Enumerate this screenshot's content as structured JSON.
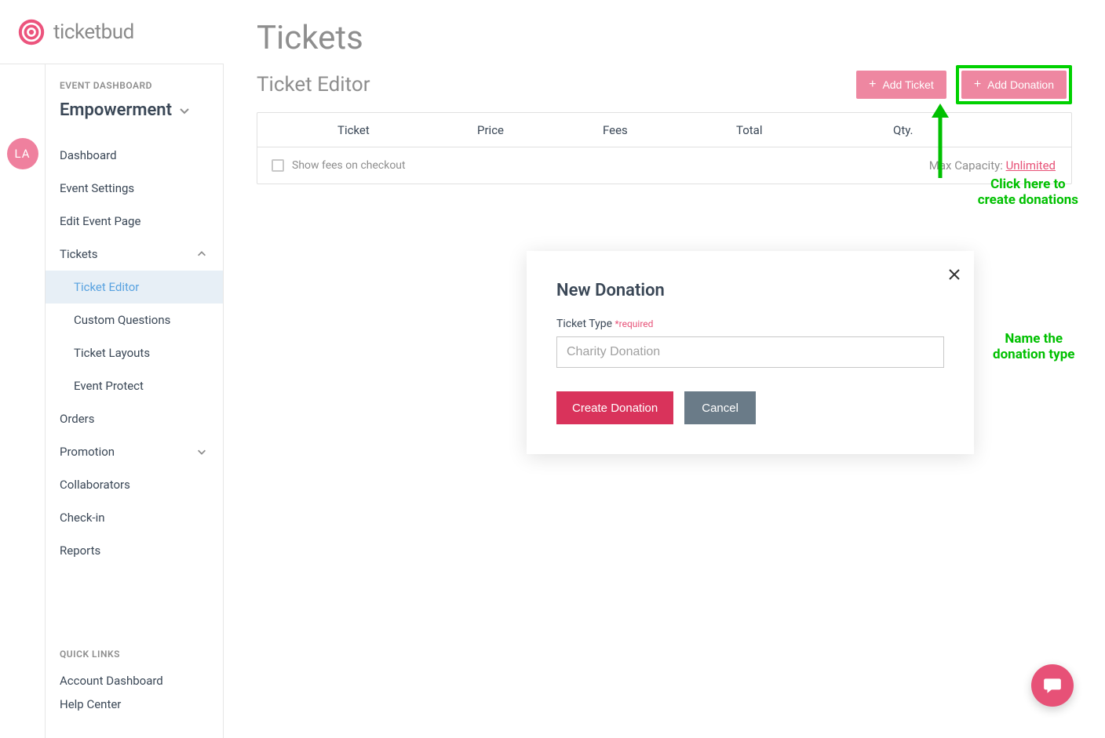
{
  "brand": {
    "name": "ticketbud",
    "avatar_initials": "LA"
  },
  "sidebar": {
    "dash_label": "EVENT DASHBOARD",
    "event_name": "Empowerment",
    "items": [
      {
        "label": "Dashboard"
      },
      {
        "label": "Event Settings"
      },
      {
        "label": "Edit Event Page"
      },
      {
        "label": "Tickets",
        "expanded": true
      },
      {
        "label": "Orders"
      },
      {
        "label": "Promotion",
        "expandable": true
      },
      {
        "label": "Collaborators"
      },
      {
        "label": "Check-in"
      },
      {
        "label": "Reports"
      }
    ],
    "tickets_sub": [
      {
        "label": "Ticket Editor",
        "active": true
      },
      {
        "label": "Custom Questions"
      },
      {
        "label": "Ticket Layouts"
      },
      {
        "label": "Event Protect"
      }
    ],
    "quick_links_label": "QUICK LINKS",
    "quick_links": [
      {
        "label": "Account Dashboard"
      },
      {
        "label": "Help Center"
      }
    ]
  },
  "page": {
    "title": "Tickets",
    "subtitle": "Ticket Editor",
    "btn_add_ticket": "Add Ticket",
    "btn_add_donation": "Add Donation",
    "table_headers": {
      "ticket": "Ticket",
      "price": "Price",
      "fees": "Fees",
      "total": "Total",
      "qty": "Qty."
    },
    "show_fees_label": "Show fees on checkout",
    "max_capacity_label": "Max Capacity: ",
    "max_capacity_value": "Unlimited"
  },
  "modal": {
    "title": "New Donation",
    "field_label": "Ticket Type ",
    "field_required": "*required",
    "placeholder": "Charity Donation",
    "btn_create": "Create Donation",
    "btn_cancel": "Cancel"
  },
  "annotations": {
    "click_here": "Click here to\ncreate donations",
    "name_type": "Name the\ndonation type"
  }
}
